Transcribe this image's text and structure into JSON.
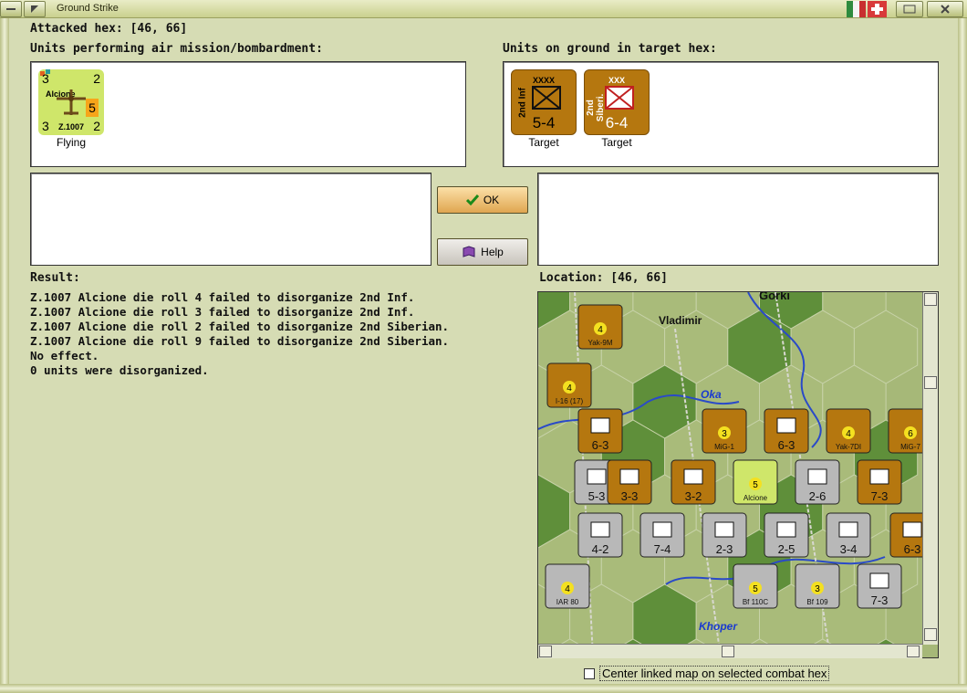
{
  "window": {
    "title": "Ground Strike"
  },
  "attacked_hex": {
    "label": "Attacked hex:",
    "value": "[46, 66]"
  },
  "air_units": {
    "heading": "Units performing air mission/bombardment:",
    "units": [
      {
        "name": "Alcione",
        "type": "Z.1007",
        "top_left": "3",
        "top_right": "2",
        "bottom_left": "3",
        "bottom_right": "2",
        "badge": "5",
        "status": "Flying"
      }
    ]
  },
  "ground_units": {
    "heading": "Units on ground in target hex:",
    "units": [
      {
        "name": "2nd Inf",
        "size": "XXXX",
        "strength": "5-4",
        "status": "Target"
      },
      {
        "name": "2nd Siberi.",
        "size": "XXX",
        "strength": "6-4",
        "status": "Target"
      }
    ]
  },
  "buttons": {
    "ok": "OK",
    "help": "Help"
  },
  "result": {
    "label": "Result:",
    "lines": [
      "Z.1007 Alcione die roll 4 failed to disorganize 2nd Inf.",
      "Z.1007 Alcione die roll 3 failed to disorganize 2nd Inf.",
      "Z.1007 Alcione die roll 2 failed to disorganize 2nd Siberian.",
      "Z.1007 Alcione die roll 9 failed to disorganize 2nd Siberian.",
      "No effect.",
      "0 units were disorganized."
    ]
  },
  "location": {
    "label": "Location:",
    "value": "[46, 66]"
  },
  "map": {
    "places": [
      "Gorki",
      "Vladimir",
      "Oka",
      "Khoper"
    ],
    "counters": [
      {
        "label": "Yak-9M",
        "value": "4"
      },
      {
        "label": "I-16 (17)",
        "value": "4"
      },
      {
        "label": "6-3",
        "value": ""
      },
      {
        "label": "MiG-1",
        "value": "3"
      },
      {
        "label": "6-3",
        "value": ""
      },
      {
        "label": "Yak-7DI",
        "value": "4"
      },
      {
        "label": "MiG-7",
        "value": "6"
      },
      {
        "label": "5-3",
        "value": ""
      },
      {
        "label": "3-3",
        "value": ""
      },
      {
        "label": "3-2",
        "value": ""
      },
      {
        "label": "Alcione",
        "value": "5"
      },
      {
        "label": "2-6",
        "value": ""
      },
      {
        "label": "7-3",
        "value": ""
      },
      {
        "label": "4-2",
        "value": ""
      },
      {
        "label": "7-4",
        "value": ""
      },
      {
        "label": "2-3",
        "value": ""
      },
      {
        "label": "2-5",
        "value": ""
      },
      {
        "label": "3-4",
        "value": ""
      },
      {
        "label": "6-3",
        "value": ""
      },
      {
        "label": "IAR 80",
        "value": "4"
      },
      {
        "label": "Bf 110C",
        "value": "5"
      },
      {
        "label": "Bf 109",
        "value": "3"
      },
      {
        "label": "7-3",
        "value": ""
      }
    ]
  },
  "options": {
    "center_map_label": "Center linked map on selected combat hex",
    "center_map_checked": false
  },
  "colors": {
    "background": "#d6dcb4",
    "soviet_counter": "#b5770f",
    "axis_counter": "#cfe66a",
    "german_counter": "#b8b8b8"
  }
}
